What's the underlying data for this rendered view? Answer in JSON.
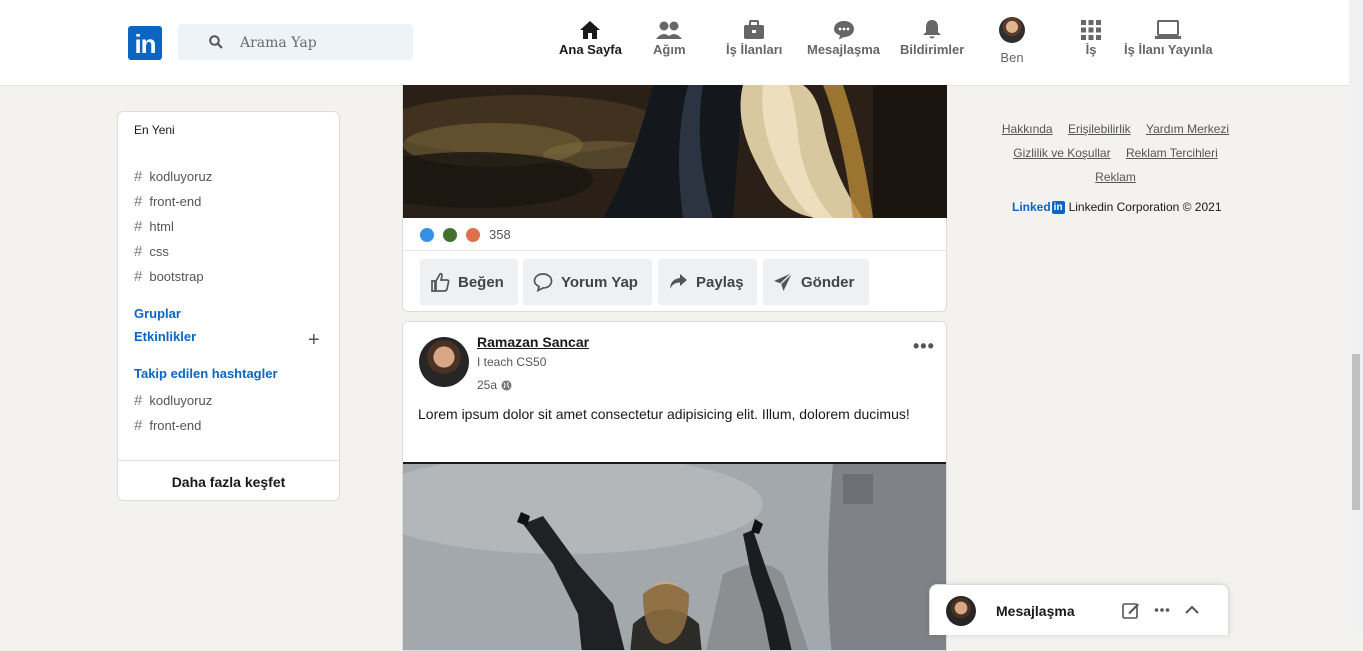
{
  "header": {
    "logo_text": "in",
    "search_placeholder": "Arama Yap",
    "nav": [
      {
        "label": "Ana Sayfa",
        "icon": "home-icon"
      },
      {
        "label": "Ağım",
        "icon": "network-icon"
      },
      {
        "label": "İş İlanları",
        "icon": "briefcase-icon"
      },
      {
        "label": "Mesajlaşma",
        "icon": "messaging-icon"
      },
      {
        "label": "Bildirimler",
        "icon": "bell-icon"
      },
      {
        "label": "Ben",
        "icon": "avatar"
      },
      {
        "label": "İş",
        "icon": "grid-icon"
      },
      {
        "label": "İş İlanı Yayınla",
        "icon": "laptop-icon"
      }
    ]
  },
  "sidebar": {
    "recent_title": "En Yeni",
    "recent_tags": [
      "kodluyoruz",
      "front-end",
      "html",
      "css",
      "bootstrap"
    ],
    "groups_label": "Gruplar",
    "events_label": "Etkinlikler",
    "add_symbol": "+",
    "followed_title": "Takip edilen hashtagler",
    "followed_tags": [
      "kodluyoruz",
      "front-end"
    ],
    "hash_symbol": "#",
    "discover_label": "Daha fazla keşfet"
  },
  "post1": {
    "reaction_count": "358",
    "actions": [
      "Beğen",
      "Yorum Yap",
      "Paylaş",
      "Gönder"
    ]
  },
  "post2": {
    "author": "Ramazan Sancar",
    "headline": "I teach CS50",
    "time": "25a",
    "text": "Lorem ipsum dolor sit amet consectetur adipisicing elit. Illum, dolorem ducimus!",
    "more_symbol": "•••"
  },
  "footer": {
    "links": [
      "Hakkında",
      "Erişilebilirlik",
      "Yardım Merkezi",
      "Gizlilik ve Koşullar",
      "Reklam Tercihleri",
      "Reklam"
    ],
    "logo_word": "Linked",
    "logo_in": "in",
    "copyright": "Linkedin Corporation © 2021"
  },
  "messaging": {
    "title": "Mesajlaşma"
  },
  "colors": {
    "brand": "#0a66c2",
    "background": "#f3f2ef"
  }
}
